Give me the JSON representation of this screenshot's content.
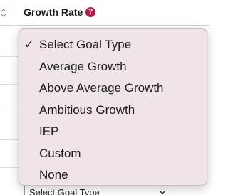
{
  "header": {
    "title": "Growth Rate",
    "help_icon": "question-circle-icon",
    "help_glyph": "?",
    "sort_icon": "sort-updown-icon"
  },
  "dropdown": {
    "selected_index": 0,
    "check_glyph": "✓",
    "options": [
      "Select Goal Type",
      "Average Growth",
      "Above Average Growth",
      "Ambitious Growth",
      "IEP",
      "Custom",
      "None"
    ]
  },
  "select": {
    "value": "Select Goal Type"
  },
  "colors": {
    "menu_background": "#efe4e6",
    "help_icon": "#b01e4f"
  }
}
